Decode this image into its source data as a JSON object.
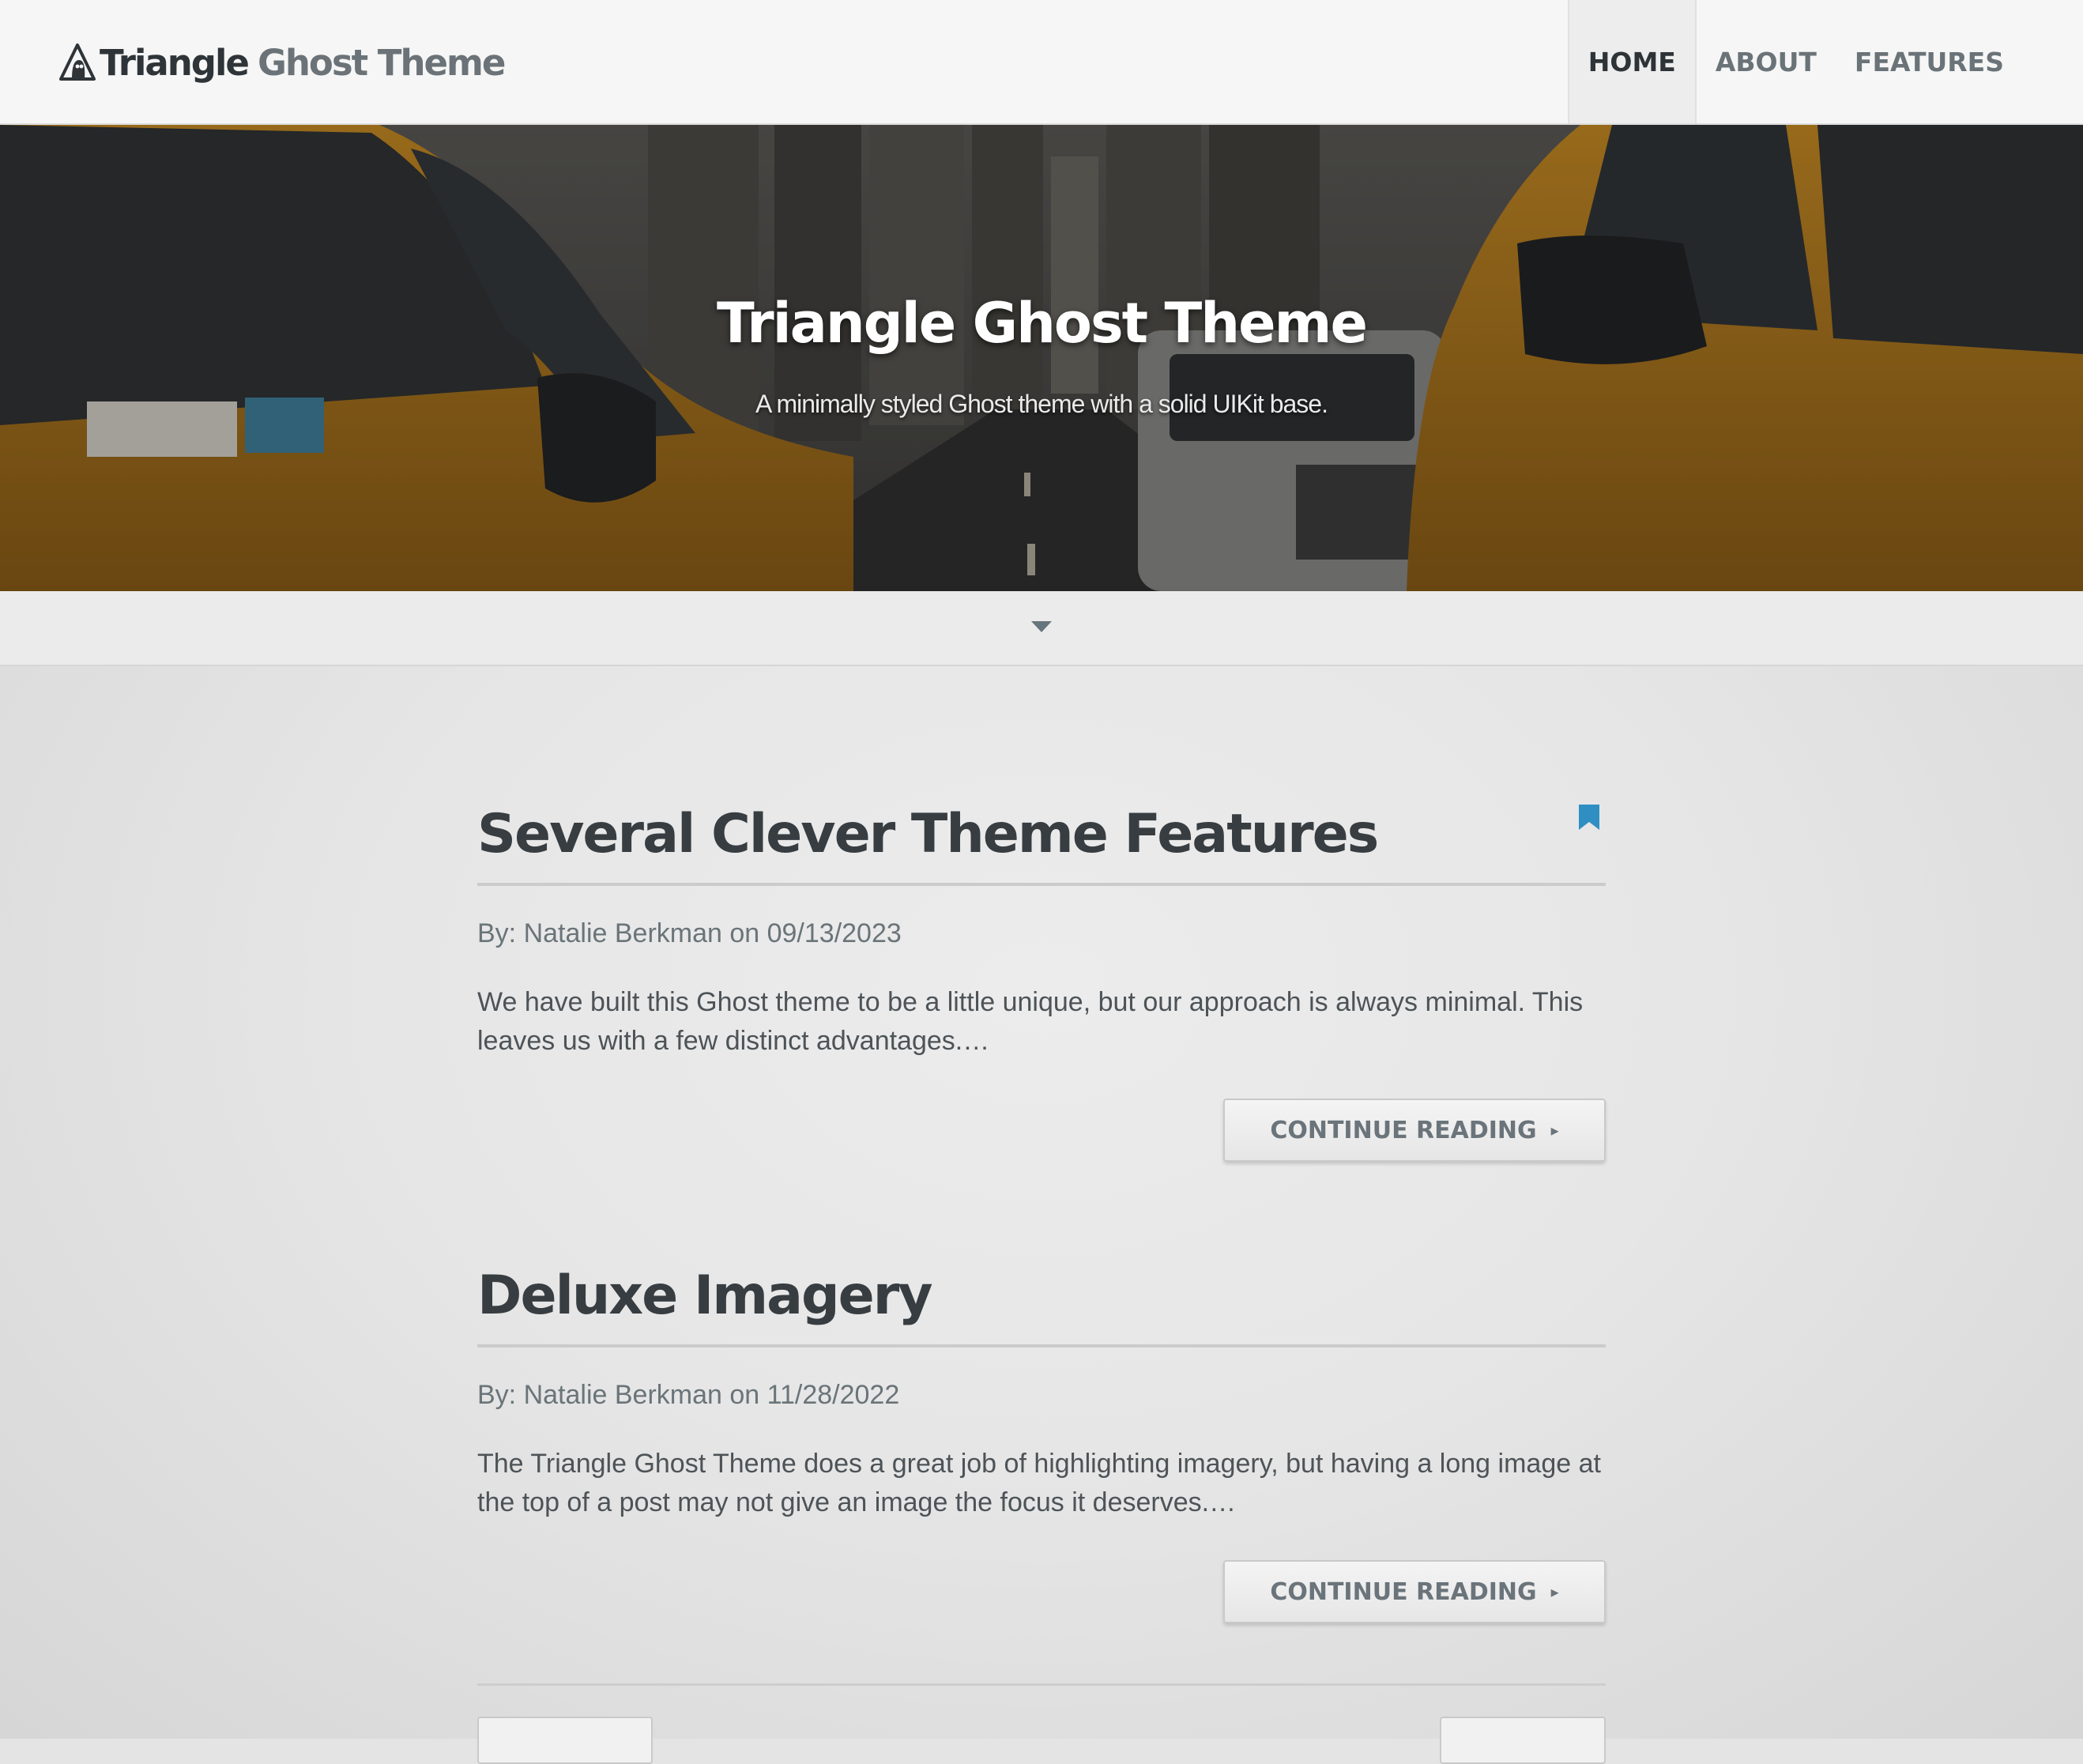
{
  "header": {
    "brand_part1": "Triangle",
    "brand_part2": "Ghost Theme",
    "nav": [
      {
        "label": "HOME",
        "active": true
      },
      {
        "label": "ABOUT",
        "active": false
      },
      {
        "label": "FEATURES",
        "active": false
      }
    ]
  },
  "hero": {
    "title": "Triangle Ghost Theme",
    "subtitle": "A minimally styled Ghost theme with a solid UIKit base."
  },
  "posts": [
    {
      "title": "Several Clever Theme Features",
      "meta": "By: Natalie Berkman on 09/13/2023",
      "excerpt": "We have built this Ghost theme to be a little unique, but our approach is always minimal. This leaves us with a few distinct advantages.…",
      "button": "CONTINUE READING",
      "featured": true
    },
    {
      "title": "Deluxe Imagery",
      "meta": "By: Natalie Berkman on 11/28/2022",
      "excerpt": "The Triangle Ghost Theme does a great job of highlighting imagery, but having a long image at the top of a post may not give an image the focus it deserves.…",
      "button": "CONTINUE READING",
      "featured": false
    }
  ],
  "colors": {
    "accent": "#2f8fc3",
    "text_dark": "#373d41",
    "text_muted": "#6a7479"
  }
}
